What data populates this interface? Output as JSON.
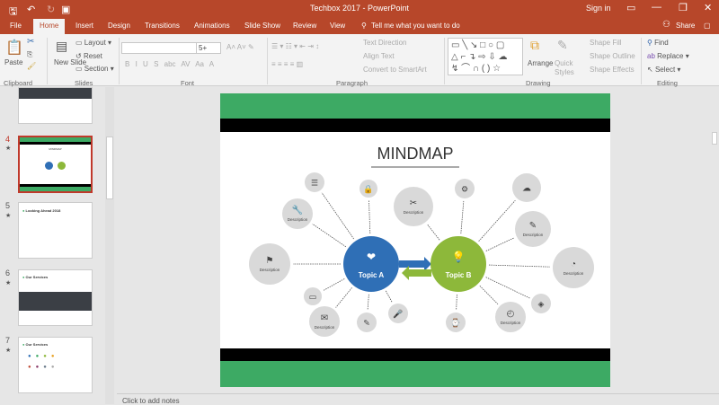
{
  "window": {
    "title": "Techbox 2017 - PowerPoint",
    "sign_in": "Sign in",
    "share": "Share"
  },
  "tabs": [
    "File",
    "Home",
    "Insert",
    "Design",
    "Transitions",
    "Animations",
    "Slide Show",
    "Review",
    "View"
  ],
  "tell_me": "Tell me what you want to do",
  "ribbon": {
    "clipboard": {
      "paste": "Paste",
      "label": "Clipboard"
    },
    "slides": {
      "new_slide": "New Slide",
      "layout": "Layout",
      "reset": "Reset",
      "section": "Section",
      "label": "Slides"
    },
    "font": {
      "size": "5+",
      "label": "Font",
      "bold": "B",
      "italic": "I",
      "underline": "U",
      "shadow": "S",
      "strike": "abc",
      "spacing": "AV",
      "case": "Aa",
      "color": "A"
    },
    "paragraph": {
      "text_direction": "Text Direction",
      "align_text": "Align Text",
      "convert": "Convert to SmartArt",
      "label": "Paragraph"
    },
    "drawing": {
      "arrange": "Arrange",
      "quick_styles": "Quick Styles",
      "shape_fill": "Shape Fill",
      "shape_outline": "Shape Outline",
      "shape_effects": "Shape Effects",
      "label": "Drawing"
    },
    "editing": {
      "find": "Find",
      "replace": "Replace",
      "select": "Select",
      "label": "Editing"
    }
  },
  "thumbnails": [
    {
      "num": "",
      "title": ""
    },
    {
      "num": "4",
      "title": "MINDMAP",
      "selected": true
    },
    {
      "num": "5",
      "title": "Looking Ahead 2018"
    },
    {
      "num": "6",
      "title": "Our Services"
    },
    {
      "num": "7",
      "title": "Our Services"
    }
  ],
  "slide": {
    "title": "MINDMAP",
    "topic_a": "Topic A",
    "topic_b": "Topic B",
    "nodes": [
      {
        "icon": "list-icon",
        "label": ""
      },
      {
        "icon": "lock-icon",
        "label": ""
      },
      {
        "icon": "tools-icon",
        "label": "Description"
      },
      {
        "icon": "gear-icon",
        "label": ""
      },
      {
        "icon": "cloud-icon",
        "label": ""
      },
      {
        "icon": "wrench-icon",
        "label": "Description"
      },
      {
        "icon": "screwdriver-icon",
        "label": "Description"
      },
      {
        "icon": "flag-icon",
        "label": "Description"
      },
      {
        "icon": "pie-chart-icon",
        "label": "Description"
      },
      {
        "icon": "monitor-icon",
        "label": ""
      },
      {
        "icon": "layers-icon",
        "label": ""
      },
      {
        "icon": "chat-icon",
        "label": "Description"
      },
      {
        "icon": "edit-icon",
        "label": ""
      },
      {
        "icon": "microphone-icon",
        "label": ""
      },
      {
        "icon": "watch-icon",
        "label": ""
      },
      {
        "icon": "speedometer-icon",
        "label": "Description"
      }
    ],
    "colors": {
      "green": "#3daa64",
      "blue": "#2f6fb6",
      "lime": "#8db83a",
      "black": "#000000"
    }
  },
  "notes_placeholder": "Click to add notes"
}
